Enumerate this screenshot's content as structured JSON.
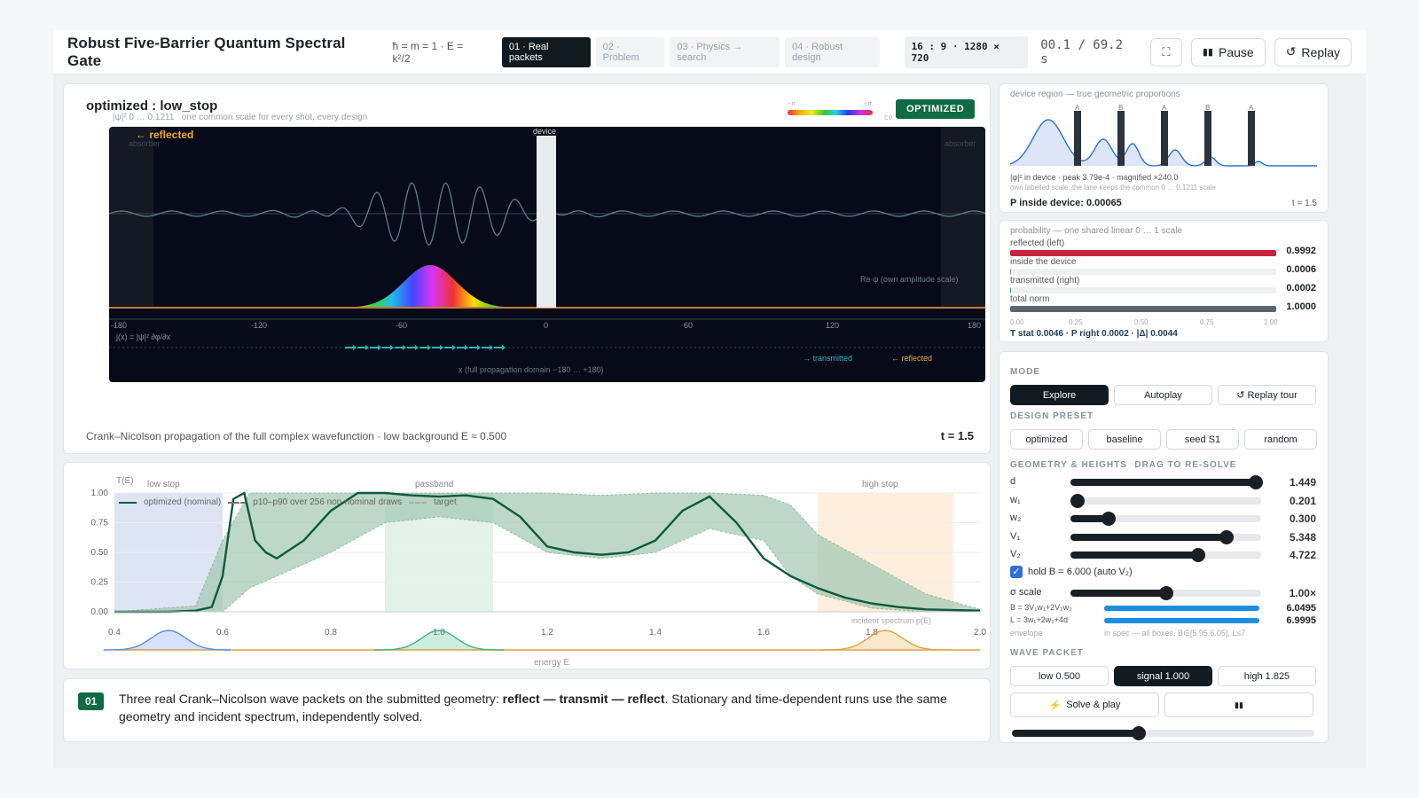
{
  "header": {
    "title": "Robust Five-Barrier Quantum Spectral Gate",
    "formula": "ħ = m = 1 · E = k²/2",
    "tabs": [
      "01 · Real packets",
      "02 · Problem",
      "03 · Physics → search",
      "04 · Robust design"
    ],
    "active_tab": 0,
    "resolution": "16 : 9 · 1280 × 720",
    "time": "00.1 / 69.2 s",
    "pause_label": "Pause",
    "replay_label": "Replay"
  },
  "sim": {
    "title": "optimized : low_stop",
    "subtitle_scale": "|ψ|²  0 … 0.1211",
    "subtitle_note": "one common scale for every shot, every design",
    "badge": "OPTIMIZED",
    "colorbar_left": "−π",
    "colorbar_right": "+π",
    "colorbar_caption": "co",
    "reflected_tag": "← reflected",
    "absorber": "absorber",
    "device_label": "device",
    "re_psi": "Re ψ  (own amplitude scale)",
    "x_ticks": [
      "-180",
      "-120",
      "-60",
      "0",
      "60",
      "120",
      "180"
    ],
    "current_label": "j(x) = |ψ|² ∂φ/∂x",
    "legend_transmitted": "→ transmitted",
    "legend_reflected": "← reflected",
    "x_caption": "x  (full propagation domain −180 … +180)",
    "footer": "Crank–Nicolson propagation of the full complex wavefunction · low background  E ≈ 0.500",
    "t": "t = 1.5"
  },
  "device": {
    "title": "device region — true geometric proportions",
    "barrier_labels": [
      "A",
      "B",
      "A",
      "B",
      "A"
    ],
    "caption1": "|φ|² in device  ·  peak 3.79e-4  ·  magnified ×240.0",
    "caption2": "own labelled scale; the lane keeps the common 0 … 0.1211 scale",
    "p_inside": "P inside device: 0.00065",
    "t": "t = 1.5"
  },
  "probability": {
    "title": "probability — one shared linear 0 … 1 scale",
    "rows": [
      {
        "label": "reflected  (left)",
        "value": "0.9992",
        "frac": 0.9992,
        "color": "#c8243e"
      },
      {
        "label": "inside the device",
        "value": "0.0006",
        "frac": 0.0006,
        "color": "#888"
      },
      {
        "label": "transmitted  (right)",
        "value": "0.0002",
        "frac": 0.0002,
        "color": "#2a9d8f"
      },
      {
        "label": "total norm",
        "value": "1.0000",
        "frac": 1.0,
        "color": "#5d6670"
      }
    ],
    "ticks": [
      "0.00",
      "0.25",
      "0.50",
      "0.75",
      "1.00"
    ],
    "stats": "T stat 0.0046  ·  P right 0.0002  ·  |Δ| 0.0044"
  },
  "controls": {
    "mode_label": "MODE",
    "modes": [
      "Explore",
      "Autoplay",
      "↺ Replay tour"
    ],
    "active_mode": 0,
    "preset_label": "DESIGN PRESET",
    "presets": [
      "optimized",
      "baseline",
      "seed S1",
      "random"
    ],
    "geom_label": "GEOMETRY & HEIGHTS",
    "geom_hint": "DRAG TO RE-SOLVE",
    "sliders": [
      {
        "name": "d",
        "value": "1.449",
        "frac": 0.97
      },
      {
        "name": "w₁",
        "value": "0.201",
        "frac": 0.0
      },
      {
        "name": "w₂",
        "value": "0.300",
        "frac": 0.2
      },
      {
        "name": "V₁",
        "value": "5.348",
        "frac": 0.82
      },
      {
        "name": "V₂",
        "value": "4.722",
        "frac": 0.67
      }
    ],
    "hold_label": "hold B = 6.000 (auto V₂)",
    "sigma_name": "σ scale",
    "sigma_value": "1.00×",
    "sigma_frac": 0.5,
    "B_eq": "B = 3V₁w₁+2V₂w₂",
    "B_value": "6.0495",
    "L_eq": "L = 3w₁+2w₂+4d",
    "L_value": "6.9995",
    "envelope_label": "envelope",
    "envelope_text": "in spec — all boxes, B∈[5.95,6.05], L≤7",
    "packet_label": "WAVE PACKET",
    "packets": [
      "low 0.500",
      "signal 1.000",
      "high 1.825"
    ],
    "active_packet": 1,
    "solve_label": "Solve & play",
    "stop_label": "▮▮",
    "progress": 0.42
  },
  "spectrum": {
    "ylabel": "T(E)",
    "xlabel": "energy  E",
    "y_ticks": [
      "1.00",
      "0.75",
      "0.50",
      "0.25",
      "0.00"
    ],
    "x_ticks": [
      "0.4",
      "0.6",
      "0.8",
      "1.0",
      "1.2",
      "1.4",
      "1.6",
      "1.8",
      "2.0"
    ],
    "zones": [
      "low stop",
      "passband",
      "high stop"
    ],
    "legend_opt": "optimized (nominal)",
    "legend_band": "p10–p90 over 256 non-nominal draws",
    "legend_target": "target",
    "incident": "incident spectrum p(E)"
  },
  "narration": {
    "step": "01",
    "text1": "Three real Crank–Nicolson wave packets on the submitted geometry: ",
    "bold": "reflect — transmit — reflect",
    "text2": ". Stationary and time-dependent runs use the same geometry and incident spectrum, independently solved."
  },
  "chart_data": {
    "type": "line",
    "title": "",
    "xlabel": "energy  E",
    "ylabel": "T(E)",
    "xlim": [
      0.4,
      2.0
    ],
    "ylim": [
      0,
      1
    ],
    "series": [
      {
        "name": "optimized (nominal)",
        "x": [
          0.4,
          0.5,
          0.55,
          0.58,
          0.6,
          0.62,
          0.64,
          0.66,
          0.68,
          0.7,
          0.75,
          0.8,
          0.85,
          0.9,
          0.95,
          1.0,
          1.05,
          1.1,
          1.15,
          1.2,
          1.25,
          1.3,
          1.35,
          1.4,
          1.45,
          1.5,
          1.55,
          1.6,
          1.65,
          1.7,
          1.75,
          1.8,
          1.85,
          1.9,
          2.0
        ],
        "y": [
          0.0,
          0.0,
          0.01,
          0.04,
          0.3,
          0.95,
          1.0,
          0.6,
          0.5,
          0.45,
          0.6,
          0.85,
          1.0,
          1.0,
          0.98,
          0.97,
          0.98,
          0.95,
          0.8,
          0.55,
          0.5,
          0.48,
          0.5,
          0.6,
          0.85,
          0.97,
          0.75,
          0.45,
          0.3,
          0.2,
          0.12,
          0.07,
          0.04,
          0.02,
          0.01
        ]
      },
      {
        "name": "p10–p90 over 256 non-nominal draws",
        "x": [
          0.4,
          0.55,
          0.6,
          0.65,
          0.7,
          0.8,
          0.9,
          1.0,
          1.1,
          1.2,
          1.3,
          1.4,
          1.5,
          1.6,
          1.65,
          1.7,
          1.8,
          1.9,
          2.0
        ],
        "y_low": [
          0.0,
          0.0,
          0.0,
          0.2,
          0.3,
          0.5,
          0.75,
          0.8,
          0.75,
          0.5,
          0.45,
          0.5,
          0.7,
          0.6,
          0.3,
          0.15,
          0.03,
          0.0,
          0.0
        ],
        "y_high": [
          0.0,
          0.05,
          0.6,
          1.0,
          1.0,
          1.0,
          1.0,
          1.0,
          1.0,
          1.0,
          0.98,
          1.0,
          1.0,
          0.98,
          0.9,
          0.65,
          0.4,
          0.15,
          0.02
        ]
      }
    ],
    "incident_spectra": [
      {
        "center": 0.5,
        "color": "#5b8de6"
      },
      {
        "center": 1.0,
        "color": "#3bb583"
      },
      {
        "center": 1.825,
        "color": "#e3a33d"
      }
    ],
    "zones": [
      {
        "label": "low stop",
        "range": [
          0.4,
          0.6
        ],
        "color": "#c7d4ec"
      },
      {
        "label": "passband",
        "range": [
          0.9,
          1.1
        ],
        "color": "#cfe9de"
      },
      {
        "label": "high stop",
        "range": [
          1.7,
          1.95
        ],
        "color": "#fde3c4"
      }
    ],
    "legend": "top-left",
    "grid": true
  }
}
